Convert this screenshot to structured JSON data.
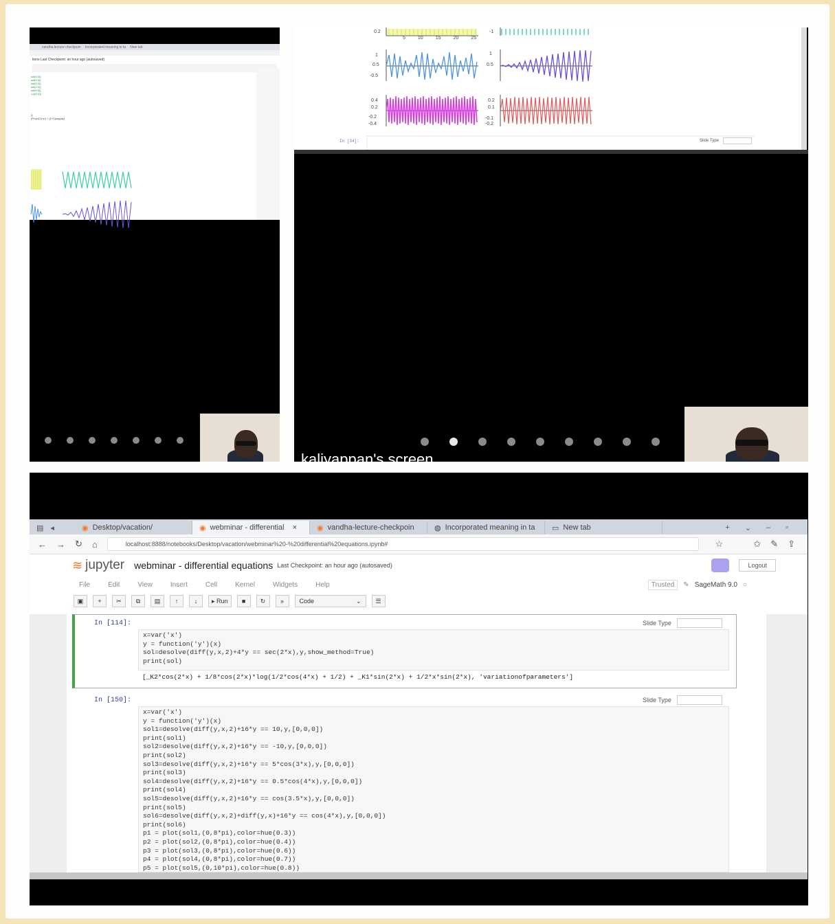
{
  "top_left": {
    "mini_tabs": [
      "vandha lecture checkpoin",
      "Incorporated meaning in ta",
      "New tab"
    ],
    "mini_title": "tions Last Checkpoint: an hour ago  (autosaved)",
    "mini_code": [
      "sol(0.0)]",
      "sol(0.0)]",
      "sol(0.0)]",
      "sol(0.0)]",
      "sol(0.0)]",
      "1,y(0,0)]"
    ],
    "mini_code2": "()",
    "mini_code3": "(Propr(2)+p) + (2+1)say(ap)",
    "dot_count": 7
  },
  "top_right": {
    "prompt": "In [34]:",
    "slide_label": "Slide Type",
    "tick_labels": [
      "5",
      "10",
      "15",
      "20",
      "25"
    ],
    "active_dot": 1,
    "dot_count": 9,
    "presenter_caption": "kaliyappan's screen",
    "plot_colors": [
      "#dfe84c",
      "#3ccf9a",
      "#4d94e0",
      "#6b4fd8",
      "#d63ce0",
      "#e06060"
    ]
  },
  "browser": {
    "tabs": [
      {
        "label": "Desktop/vacation/",
        "icon": "jupyter-icon"
      },
      {
        "label": "webminar - differential",
        "icon": "jupyter-icon"
      },
      {
        "label": "vandha-lecture-checkpoin",
        "icon": "jupyter-icon"
      },
      {
        "label": "Incorporated meaning in ta",
        "icon": "globe-icon"
      },
      {
        "label": "New tab",
        "icon": "tab-icon"
      }
    ],
    "url": "localhost:8888/notebooks/Desktop/vacation/webminar%20-%20differential%20equations.ipynb#"
  },
  "jupyter": {
    "logo": "jupyter",
    "notebook_title": "webminar - differential equations",
    "checkpoint": "Last Checkpoint: an hour ago  (autosaved)",
    "logout": "Logout",
    "menu": [
      "File",
      "Edit",
      "View",
      "Insert",
      "Cell",
      "Kernel",
      "Widgets",
      "Help"
    ],
    "trusted": "Trusted",
    "kernel": "SageMath 9.0",
    "run_label": "Run",
    "cell_type": "Code"
  },
  "cells": [
    {
      "prompt": "In [114]:",
      "slide_type_label": "Slide Type",
      "code": "x=var('x')\ny = function('y')(x)\nsol=desolve(diff(y,x,2)+4*y == sec(2*x),y,show_method=True)\nprint(sol)",
      "output": "[_K2*cos(2*x) + 1/8*cos(2*x)*log(1/2*cos(4*x) + 1/2) + _K1*sin(2*x) + 1/2*x*sin(2*x), 'variationofparameters']"
    },
    {
      "prompt": "In [150]:",
      "slide_type_label": "Slide Type",
      "code": "x=var('x')\ny = function('y')(x)\nsol1=desolve(diff(y,x,2)+16*y == 10,y,[0,0,0])\nprint(sol1)\nsol2=desolve(diff(y,x,2)+16*y == -10,y,[0,0,0])\nprint(sol2)\nsol3=desolve(diff(y,x,2)+16*y == 5*cos(3*x),y,[0,0,0])\nprint(sol3)\nsol4=desolve(diff(y,x,2)+16*y == 0.5*cos(4*x),y,[0,0,0])\nprint(sol4)\nsol5=desolve(diff(y,x,2)+16*y == cos(3.5*x),y,[0,0,0])\nprint(sol5)\nsol6=desolve(diff(y,x,2)+diff(y,x)+16*y == cos(4*x),y,[0,0,0])\nprint(sol6)\np1 = plot(sol1,(0,8*pi),color=hue(0.3))\np2 = plot(sol2,(0,8*pi),color=hue(0.4))\np3 = plot(sol3,(0,8*pi),color=hue(0.6))\np4 = plot(sol4,(0,8*pi),color=hue(0.7))\np5 = plot(sol5,(0,10*pi),color=hue(0.8))"
    }
  ]
}
